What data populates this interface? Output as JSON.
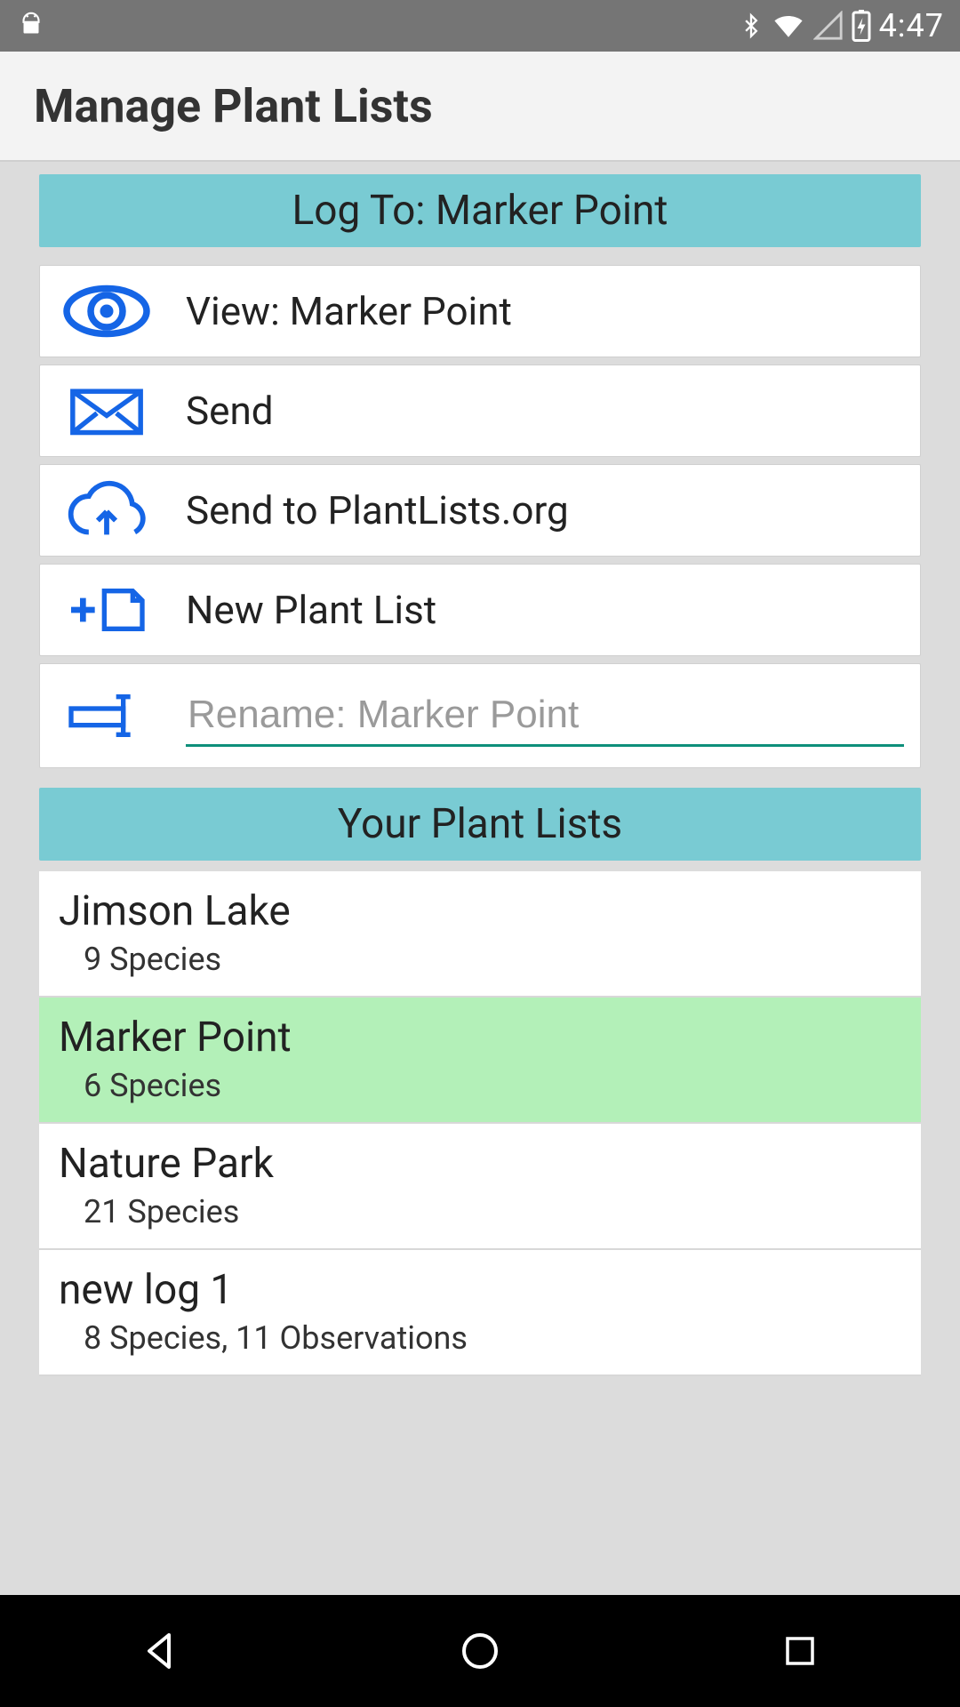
{
  "status": {
    "time": "4:47"
  },
  "appbar": {
    "title": "Manage Plant Lists"
  },
  "section1": {
    "header": "Log To: Marker Point"
  },
  "actions": {
    "view": {
      "label": "View: Marker Point"
    },
    "send": {
      "label": "Send"
    },
    "upload": {
      "label": "Send to PlantLists.org"
    },
    "new": {
      "label": "New Plant List"
    },
    "rename": {
      "placeholder": "Rename: Marker Point"
    }
  },
  "section2": {
    "header": "Your Plant Lists"
  },
  "lists": [
    {
      "name": "Jimson Lake",
      "detail": "9 Species",
      "selected": false
    },
    {
      "name": "Marker Point",
      "detail": "6 Species",
      "selected": true
    },
    {
      "name": "Nature Park",
      "detail": "21 Species",
      "selected": false
    },
    {
      "name": "new log 1",
      "detail": "8 Species, 11 Observations",
      "selected": false
    }
  ],
  "colors": {
    "accent": "#1565e6",
    "header": "#79cbd3",
    "selected": "#b3f0b8",
    "underline": "#0e8f7b"
  }
}
